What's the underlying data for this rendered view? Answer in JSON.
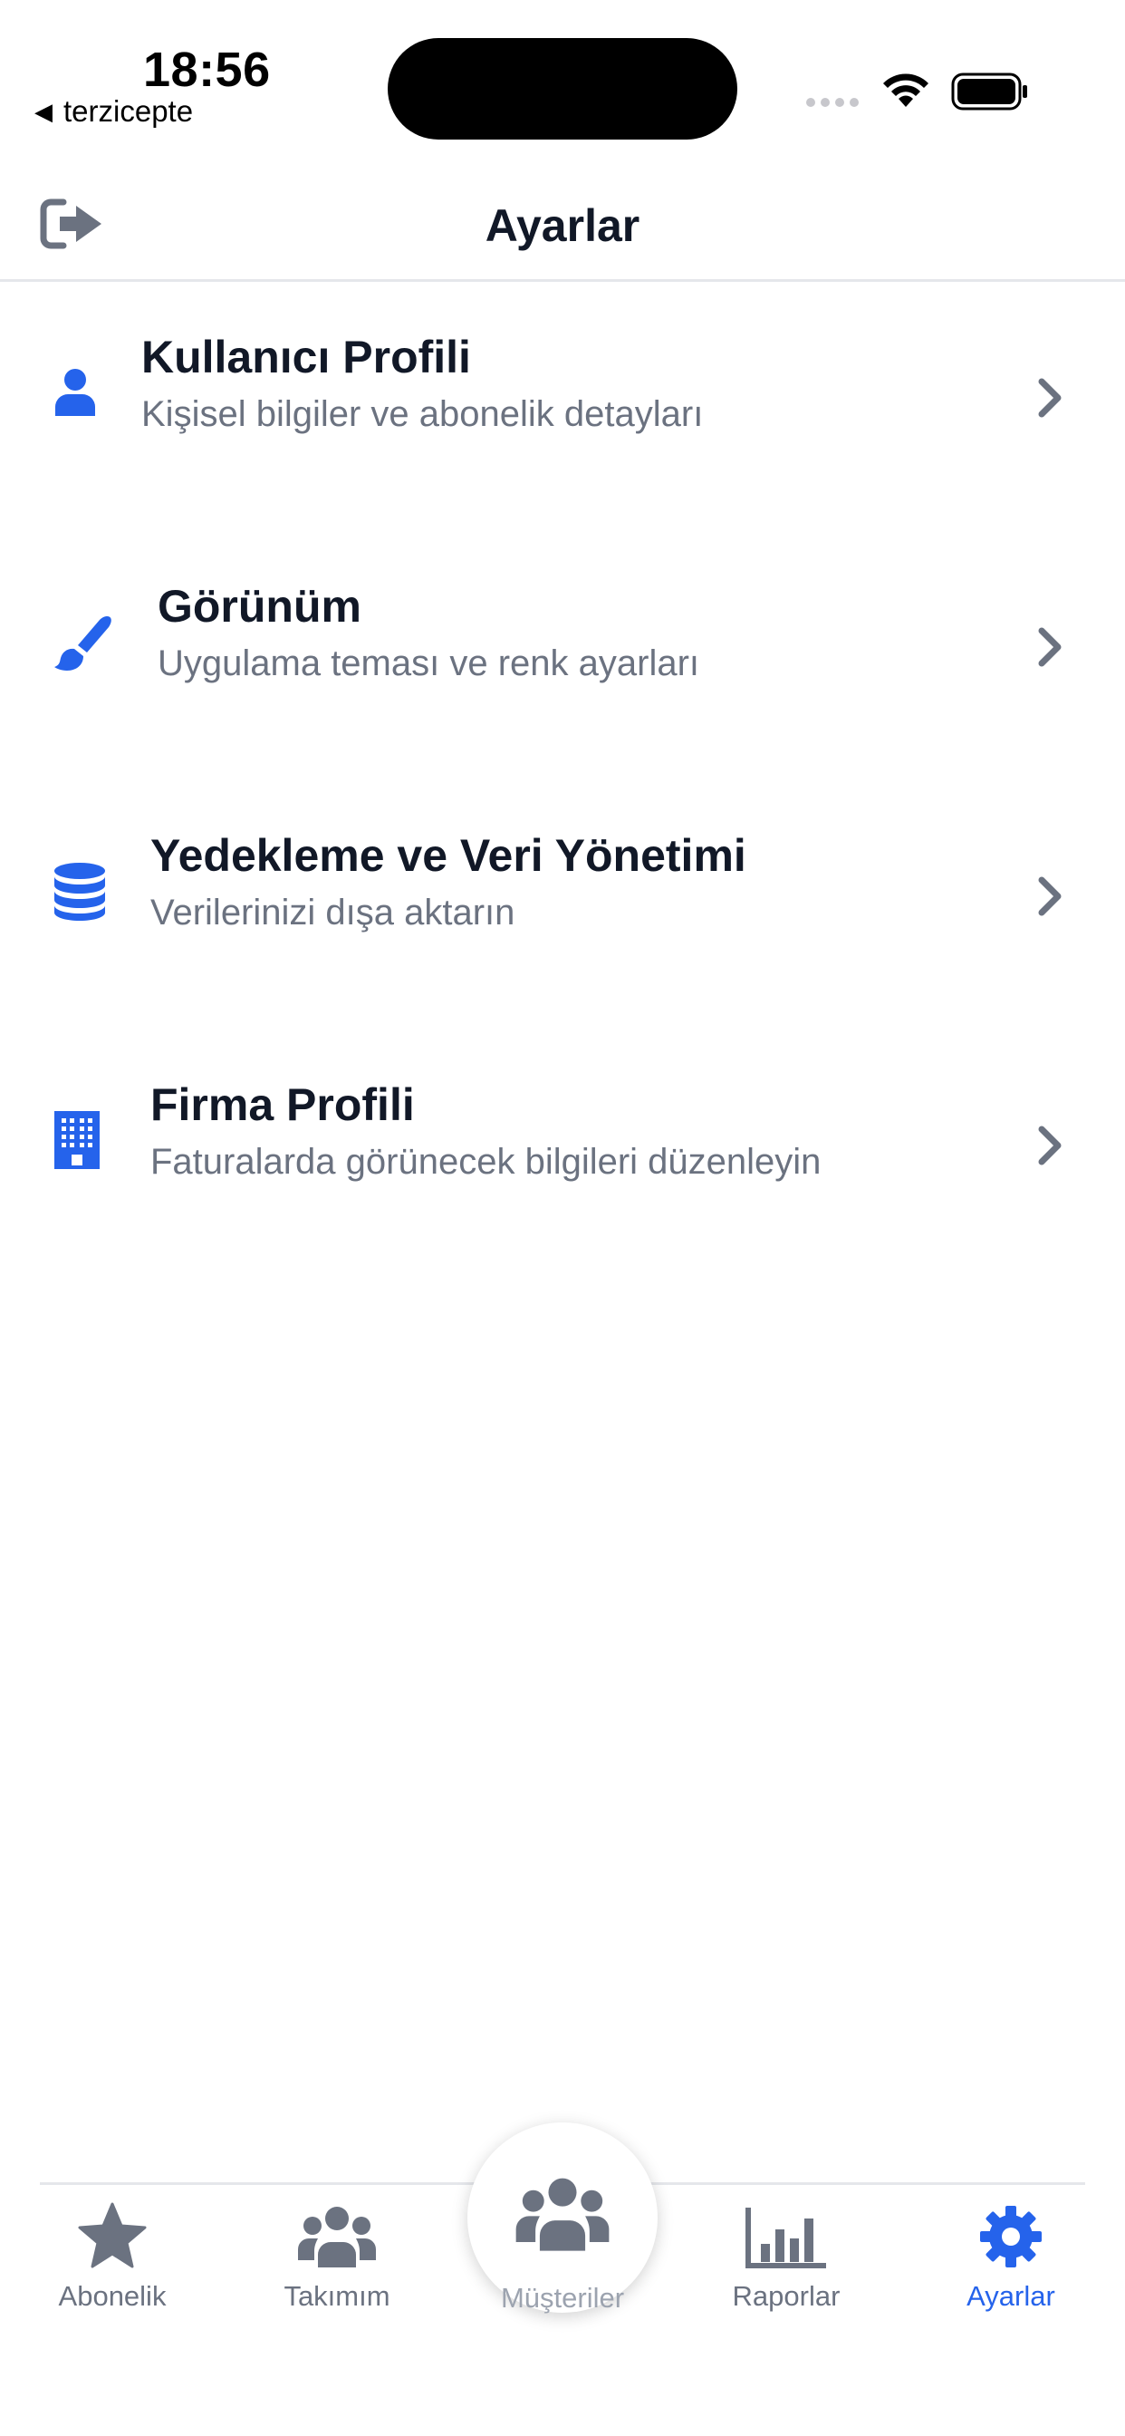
{
  "status_bar": {
    "time": "18:56",
    "back_app_label": "terzicepte",
    "back_icon": "triangle-left-icon"
  },
  "header": {
    "title": "Ayarlar",
    "logout_icon": "logout-icon"
  },
  "settings": {
    "items": [
      {
        "icon": "user-icon",
        "title": "Kullanıcı Profili",
        "subtitle": "Kişisel bilgiler ve abonelik detayları"
      },
      {
        "icon": "paintbrush-icon",
        "title": "Görünüm",
        "subtitle": "Uygulama teması ve renk ayarları"
      },
      {
        "icon": "database-icon",
        "title": "Yedekleme ve Veri Yönetimi",
        "subtitle": "Verilerinizi dışa aktarın"
      },
      {
        "icon": "building-icon",
        "title": "Firma Profili",
        "subtitle": "Faturalarda görünecek bilgileri düzenleyin"
      }
    ]
  },
  "tabbar": {
    "tabs": [
      {
        "label": "Abonelik",
        "icon": "star-icon",
        "active": false
      },
      {
        "label": "Takımım",
        "icon": "users-icon",
        "active": false
      },
      {
        "label": "Müşteriler",
        "icon": "users-icon",
        "active": false,
        "center": true
      },
      {
        "label": "Raporlar",
        "icon": "bar-chart-icon",
        "active": false
      },
      {
        "label": "Ayarlar",
        "icon": "gear-icon",
        "active": true
      }
    ]
  },
  "colors": {
    "accent": "#2563eb",
    "text_primary": "#111827",
    "text_secondary": "#6b7280",
    "divider": "#e5e7eb"
  }
}
